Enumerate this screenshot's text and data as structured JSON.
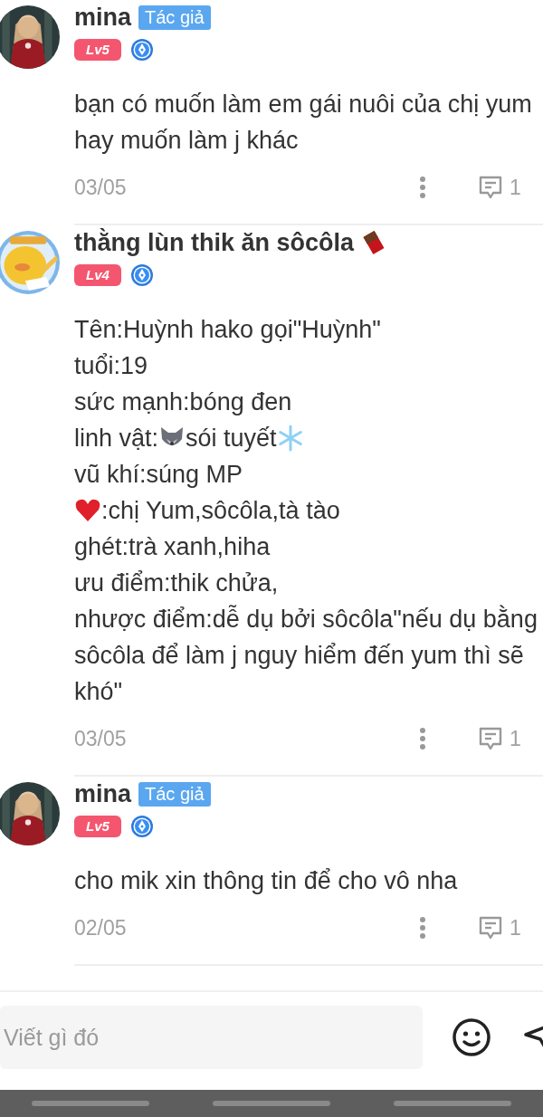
{
  "comments": [
    {
      "author": "mina",
      "author_badge": "Tác giả",
      "level": "Lv5",
      "lines": [
        [
          {
            "kind": "text",
            "text": "bạn có muốn làm em gái nuôi của chị yum"
          }
        ],
        [
          {
            "kind": "text",
            "text": "hay muốn làm j khác"
          }
        ]
      ],
      "date": "03/05",
      "reply_count": "1"
    },
    {
      "author": "thằng lùn thik ăn sôcôla",
      "name_icon": {
        "kind": "chocolate"
      },
      "level": "Lv4",
      "lines": [
        [
          {
            "kind": "text",
            "text": "Tên:Huỳnh hako gọi\"Huỳnh\""
          }
        ],
        [
          {
            "kind": "text",
            "text": "tuổi:19"
          }
        ],
        [
          {
            "kind": "text",
            "text": "sức mạnh:bóng đen"
          }
        ],
        [
          {
            "kind": "text",
            "text": "linh vật:"
          },
          {
            "kind": "wolf"
          },
          {
            "kind": "text",
            "text": "sói tuyết"
          },
          {
            "kind": "snowflake"
          }
        ],
        [
          {
            "kind": "text",
            "text": "vũ khí:súng MP"
          }
        ],
        [
          {
            "kind": "heart"
          },
          {
            "kind": "text",
            "text": ":chị Yum,sôcôla,tà tào"
          }
        ],
        [
          {
            "kind": "text",
            "text": "ghét:trà xanh,hiha"
          }
        ],
        [
          {
            "kind": "text",
            "text": "ưu điểm:thik chửa,"
          }
        ],
        [
          {
            "kind": "text",
            "text": "nhược điểm:dễ dụ bởi sôcôla\"nếu dụ bằng"
          }
        ],
        [
          {
            "kind": "text",
            "text": "sôcôla để làm j nguy hiểm đến yum thì sẽ"
          }
        ],
        [
          {
            "kind": "text",
            "text": "khó\""
          }
        ]
      ],
      "date": "03/05",
      "reply_count": "1"
    },
    {
      "author": "mina",
      "author_badge": "Tác giả",
      "level": "Lv5",
      "lines": [
        [
          {
            "kind": "text",
            "text": "cho mik xin thông tin để cho vô nha"
          }
        ]
      ],
      "date": "02/05",
      "reply_count": "1"
    }
  ],
  "composer": {
    "placeholder": "Viết gì đó"
  }
}
